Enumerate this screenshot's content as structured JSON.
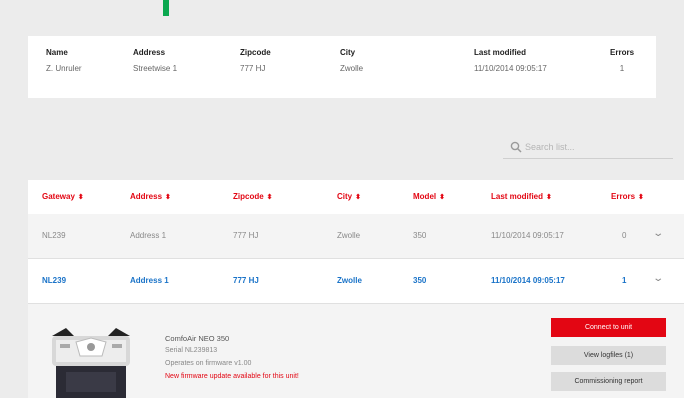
{
  "summary": {
    "headers": {
      "name": "Name",
      "address": "Address",
      "zipcode": "Zipcode",
      "city": "City",
      "last_modified": "Last modified",
      "errors": "Errors"
    },
    "values": {
      "name": "Z. Unruler",
      "address": "Streetwise 1",
      "zipcode": "777 HJ",
      "city": "Zwolle",
      "last_modified": "11/10/2014 09:05:17",
      "errors": "1"
    }
  },
  "search": {
    "placeholder": "Search list..."
  },
  "table": {
    "headers": {
      "gateway": "Gateway",
      "address": "Address",
      "zipcode": "Zipcode",
      "city": "City",
      "model": "Model",
      "last_modified": "Last modified",
      "errors": "Errors"
    },
    "sort_icon": "sort-arrows-icon",
    "rows": [
      {
        "gateway": "NL239",
        "address": "Address 1",
        "zipcode": "777 HJ",
        "city": "Zwolle",
        "model": "350",
        "last_modified": "11/10/2014 09:05:17",
        "errors": "0"
      },
      {
        "gateway": "NL239",
        "address": "Address 1",
        "zipcode": "777 HJ",
        "city": "Zwolle",
        "model": "350",
        "last_modified": "11/10/2014 09:05:17",
        "errors": "1"
      }
    ]
  },
  "detail": {
    "device_name": "ComfoAir NEO 350",
    "serial": "Serial NL239813",
    "firmware": "Operates on firmware v1.00",
    "firmware_warning": "New firmware update available for this unit!"
  },
  "buttons": {
    "connect": "Connect to unit",
    "view_logfiles": "View logfiles (1)",
    "commissioning": "Commissioning report"
  },
  "colors": {
    "accent_red": "#e30613",
    "link_blue": "#1a73c8",
    "marker_green": "#0aa84f"
  }
}
